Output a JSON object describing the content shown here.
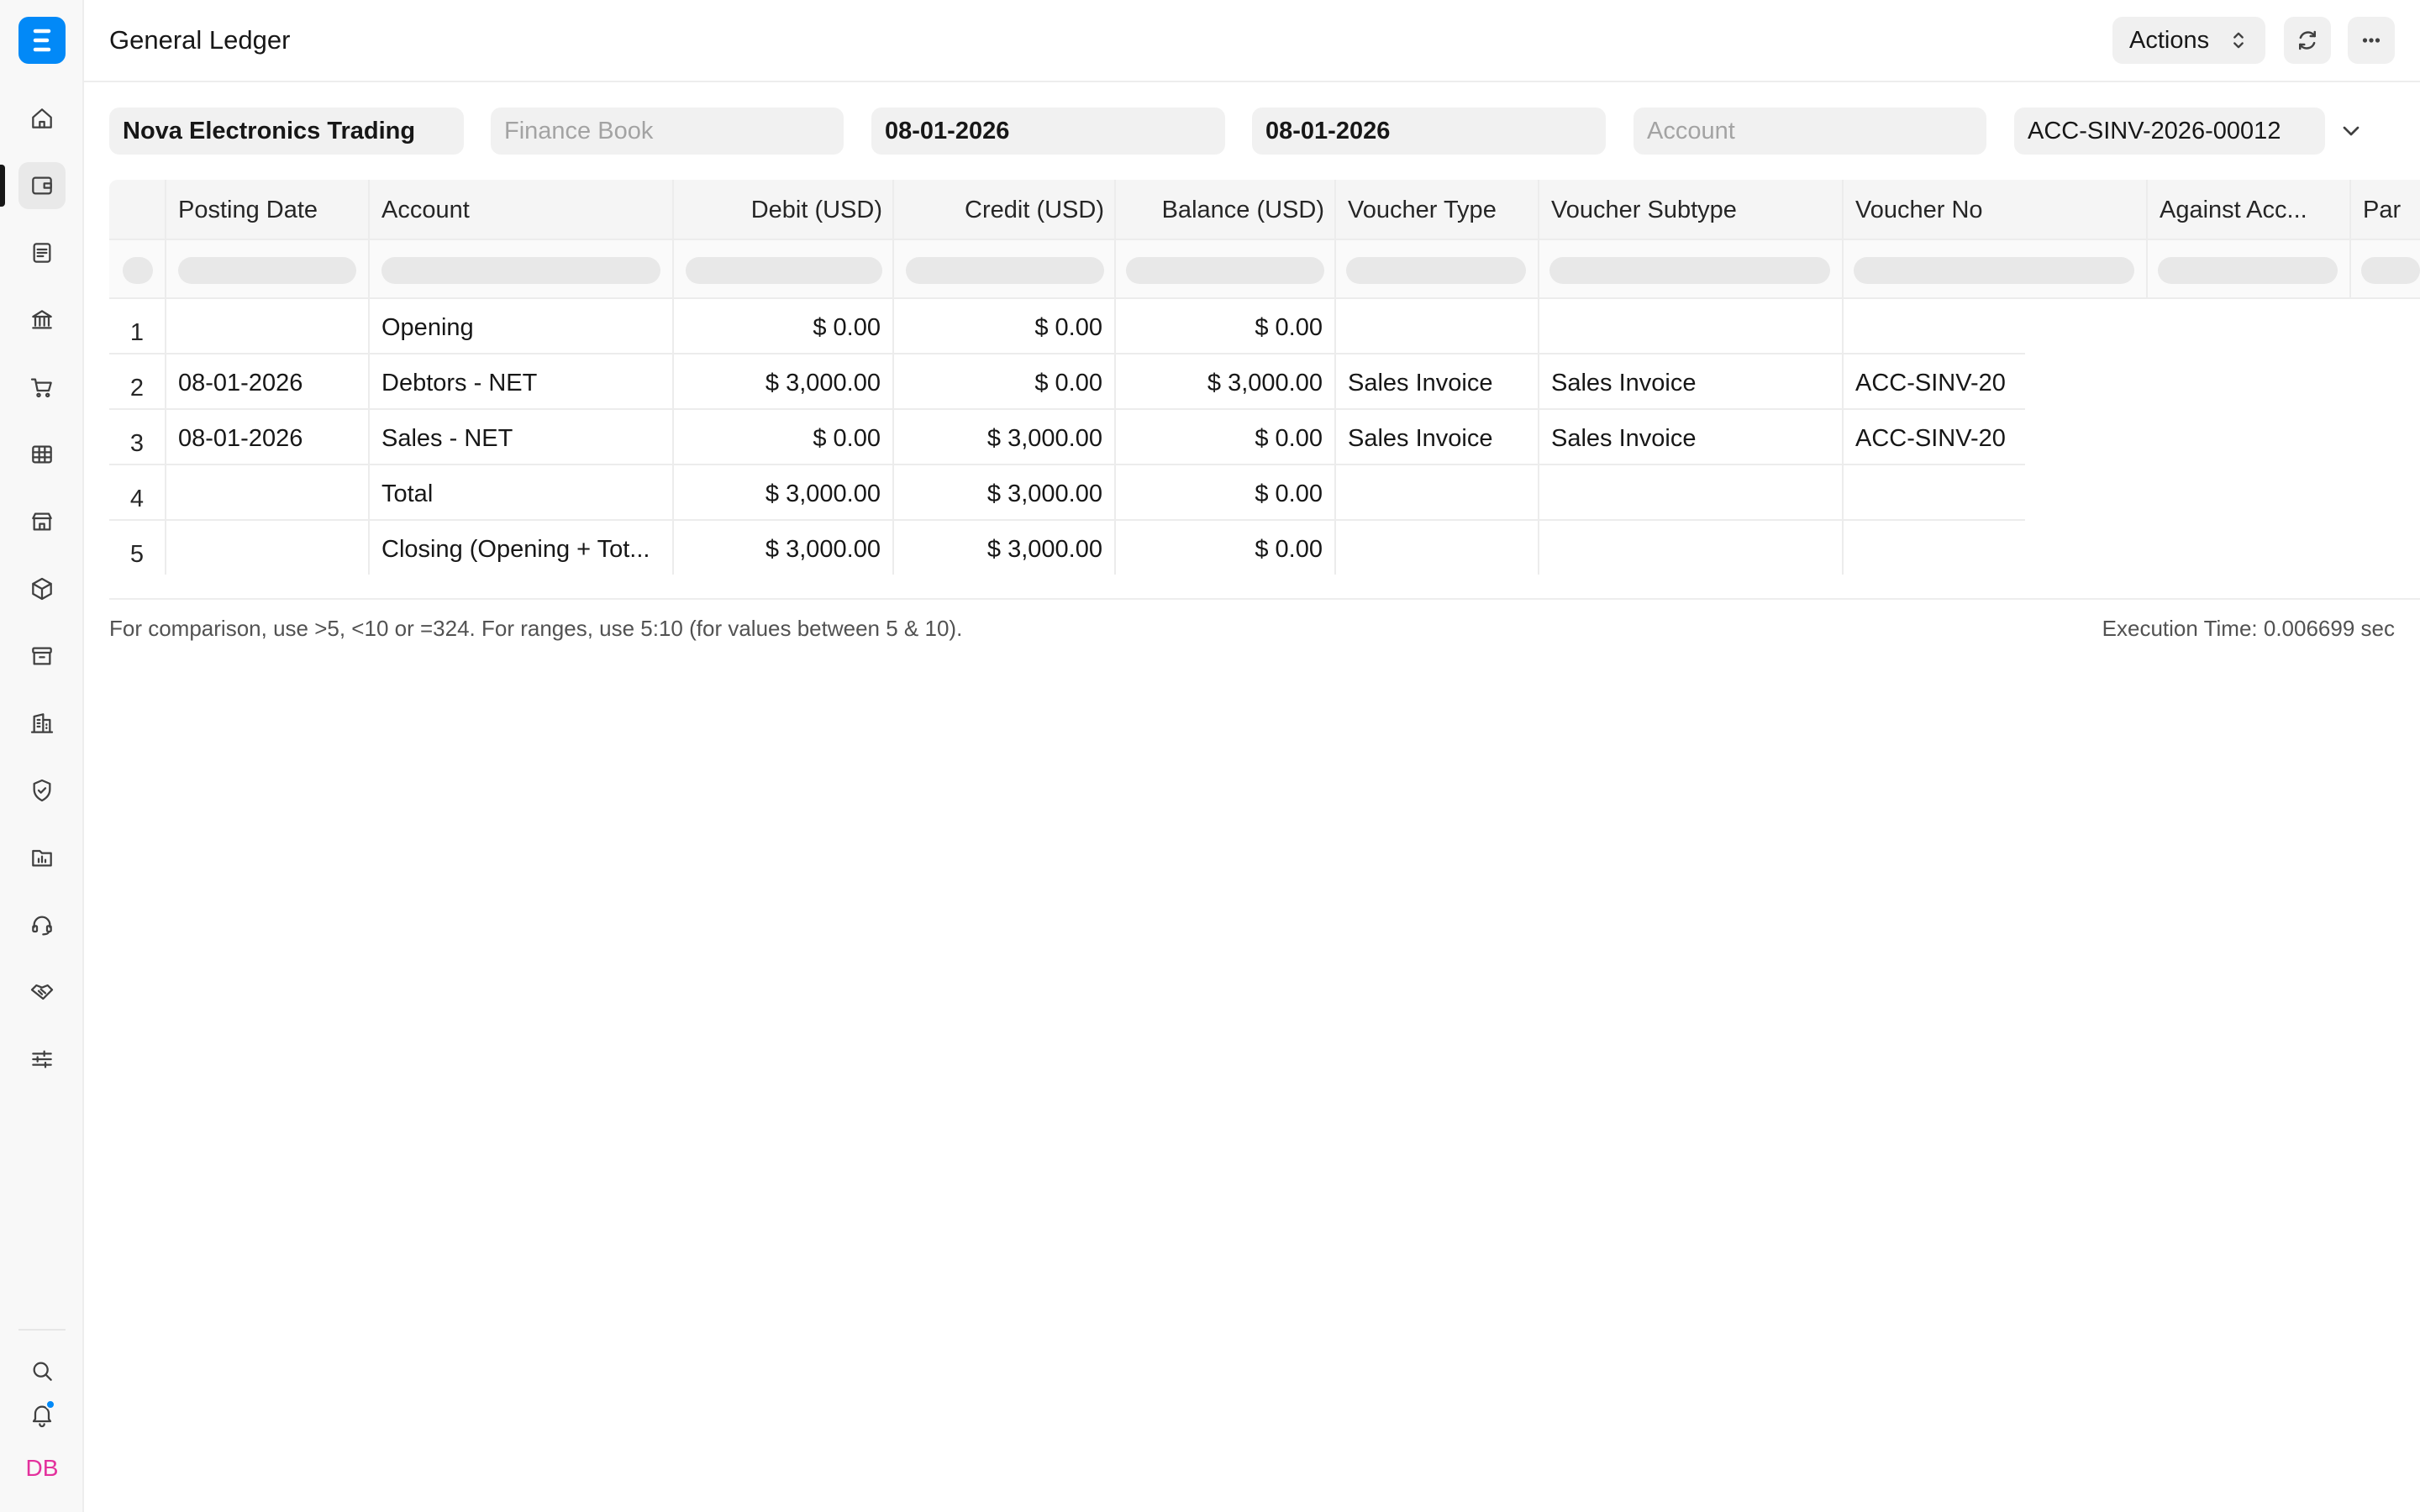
{
  "app": {
    "brand_letter": "E",
    "brand_color": "#0289f7"
  },
  "header": {
    "title": "General Ledger",
    "actions_label": "Actions"
  },
  "sidebar": {
    "items": [
      {
        "icon": "home-icon"
      },
      {
        "icon": "wallet-icon",
        "active": true
      },
      {
        "icon": "document-icon"
      },
      {
        "icon": "bank-icon"
      },
      {
        "icon": "cart-icon"
      },
      {
        "icon": "table-icon"
      },
      {
        "icon": "store-icon"
      },
      {
        "icon": "box-icon"
      },
      {
        "icon": "archive-icon"
      },
      {
        "icon": "building-icon"
      },
      {
        "icon": "shield-icon"
      },
      {
        "icon": "folder-chart-icon"
      },
      {
        "icon": "headset-icon"
      },
      {
        "icon": "handshake-icon"
      },
      {
        "icon": "sliders-icon"
      }
    ],
    "avatar_initials": "DB"
  },
  "filters": {
    "company": "Nova Electronics Trading",
    "finance_book_placeholder": "Finance Book",
    "from_date": "08-01-2026",
    "to_date": "08-01-2026",
    "account_placeholder": "Account",
    "voucher_no": "ACC-SINV-2026-00012"
  },
  "table": {
    "columns": [
      "Posting Date",
      "Account",
      "Debit (USD)",
      "Credit (USD)",
      "Balance (USD)",
      "Voucher Type",
      "Voucher Subtype",
      "Voucher No",
      "Against Acc...",
      "Par"
    ],
    "rows": [
      {
        "idx": "1",
        "posting_date": "",
        "account": "Opening",
        "debit": "$ 0.00",
        "credit": "$ 0.00",
        "balance": "$ 0.00",
        "voucher_type": "",
        "voucher_subtype": "",
        "voucher_no": ""
      },
      {
        "idx": "2",
        "posting_date": "08-01-2026",
        "account": "Debtors - NET",
        "debit": "$ 3,000.00",
        "credit": "$ 0.00",
        "balance": "$ 3,000.00",
        "voucher_type": "Sales Invoice",
        "voucher_subtype": "Sales Invoice",
        "voucher_no": "ACC-SINV-20"
      },
      {
        "idx": "3",
        "posting_date": "08-01-2026",
        "account": "Sales - NET",
        "debit": "$ 0.00",
        "credit": "$ 3,000.00",
        "balance": "$ 0.00",
        "voucher_type": "Sales Invoice",
        "voucher_subtype": "Sales Invoice",
        "voucher_no": "ACC-SINV-20"
      },
      {
        "idx": "4",
        "posting_date": "",
        "account": "Total",
        "debit": "$ 3,000.00",
        "credit": "$ 3,000.00",
        "balance": "$ 0.00",
        "voucher_type": "",
        "voucher_subtype": "",
        "voucher_no": ""
      },
      {
        "idx": "5",
        "posting_date": "",
        "account": "Closing (Opening + Tot...",
        "debit": "$ 3,000.00",
        "credit": "$ 3,000.00",
        "balance": "$ 0.00",
        "voucher_type": "",
        "voucher_subtype": "",
        "voucher_no": ""
      }
    ]
  },
  "footer": {
    "note": "For comparison, use >5, <10 or =324. For ranges, use 5:10 (for values between 5 & 10).",
    "execution_time": "Execution Time: 0.006699 sec"
  }
}
